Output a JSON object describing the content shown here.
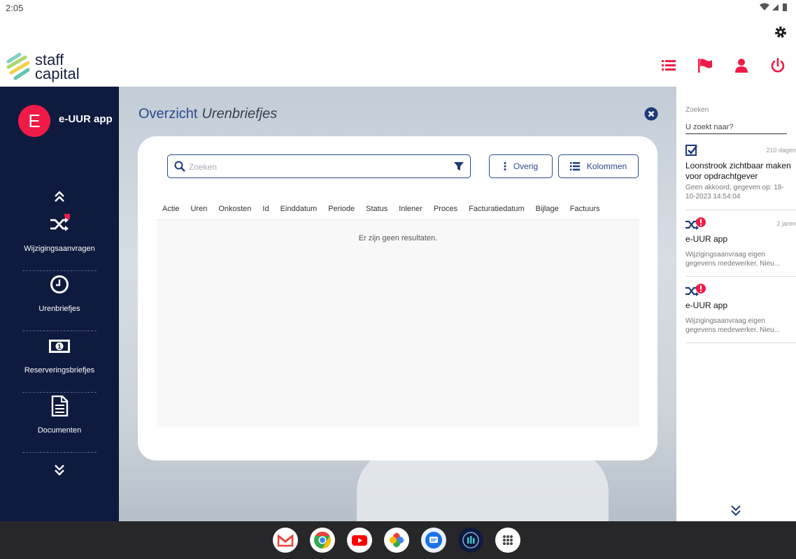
{
  "status_bar": {
    "time": "2:05"
  },
  "brand": {
    "line1": "staff",
    "line2": "capital"
  },
  "icons": {
    "settings": "gear-icon",
    "list": "list-icon",
    "flag": "flag-icon",
    "user": "user-icon",
    "power": "power-icon",
    "search": "search-icon",
    "filter": "filter-icon",
    "close": "close-icon"
  },
  "colors": {
    "accent": "#ef1b46",
    "navy": "#0e1a3e",
    "primary": "#2b4a8c"
  },
  "sidebar": {
    "app_initial": "E",
    "app_name": "e-UUR app",
    "items": [
      {
        "label": "Wijzigingsaanvragen",
        "icon": "shuffle-icon"
      },
      {
        "label": "Urenbriefjes",
        "icon": "clock-icon"
      },
      {
        "label": "Reserveringsbriefjes",
        "icon": "money-icon"
      },
      {
        "label": "Documenten",
        "icon": "document-icon"
      }
    ]
  },
  "main": {
    "title": "Overzicht",
    "subtitle": "Urenbriefjes",
    "search_placeholder": "Zoeken",
    "buttons": {
      "overig": "Overig",
      "kolommen": "Kolommen"
    },
    "columns": [
      "Actie",
      "Uren",
      "Onkosten",
      "Id",
      "Einddatum",
      "Periode",
      "Status",
      "Inlener",
      "Proces",
      "Facturatiedatum",
      "Bijlage",
      "Factuurs"
    ],
    "empty_message": "Er zijn geen resultaten."
  },
  "right_panel": {
    "search_label": "Zoeken",
    "search_placeholder": "U zoekt naar?",
    "notifications": [
      {
        "icon": "checkbox-icon",
        "age": "210 dagen",
        "title": "Loonstrook zichtbaar maken voor opdrachtgever",
        "description": "Geen akkoord, gegeven op: 18-10-2023 14:54:04"
      },
      {
        "icon": "shuffle-alert-icon",
        "age": "2 jaren",
        "title": "e-UUR app",
        "description": "Wijzigingsaanvraag eigen gegevens medewerker, Nieu..."
      },
      {
        "icon": "shuffle-alert-icon",
        "age": "",
        "title": "e-UUR app",
        "description": "Wijzigingsaanvraag eigen gegevens medewerker, Nieu..."
      }
    ]
  },
  "dock": [
    "gmail-icon",
    "chrome-icon",
    "youtube-icon",
    "photos-icon",
    "messages-icon",
    "app-icon",
    "app-drawer-icon"
  ]
}
